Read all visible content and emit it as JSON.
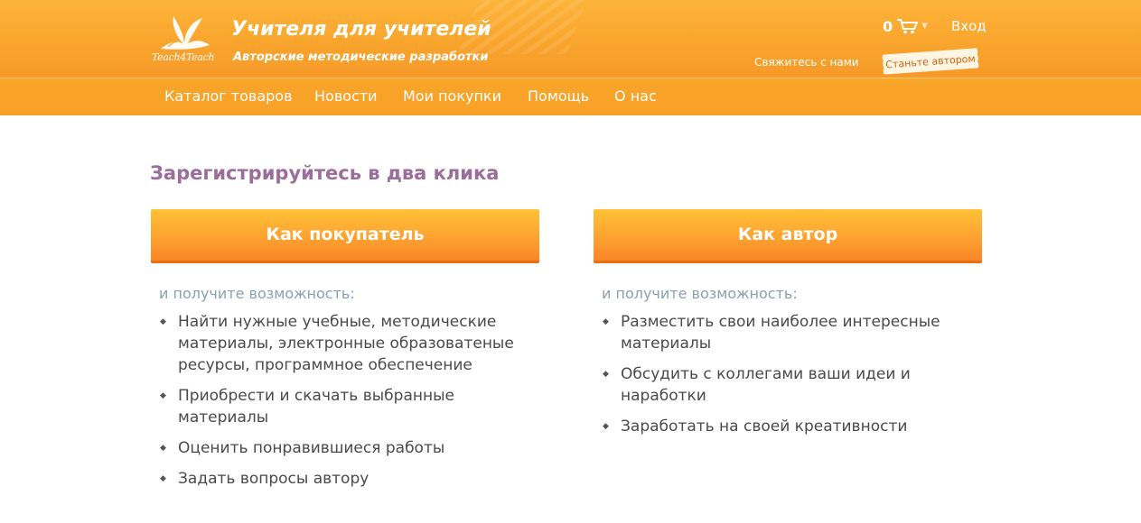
{
  "header": {
    "logo_text": "Teach4Teach",
    "site_title": "Учителя для учителей",
    "site_subtitle": "Авторские методические разработки",
    "cart_count": "0",
    "login_label": "Вход",
    "contact_label": "Свяжитесь с нами",
    "become_author_label": "Станьте автором"
  },
  "nav": {
    "items": [
      {
        "label": "Каталог товаров"
      },
      {
        "label": "Новости"
      },
      {
        "label": "Мои покупки"
      },
      {
        "label": "Помощь"
      },
      {
        "label": "О нас"
      }
    ]
  },
  "main": {
    "title": "Зарегистрируйтесь в два клика",
    "buyer": {
      "button_label": "Как покупатель",
      "intro": "и получите возможность:",
      "features": [
        "Найти нужные учебные, методические материалы, электронные образоватеные ресурсы, программное обеспечение",
        "Приобрести и скачать выбранные материалы",
        "Оценить понравившиеся работы",
        "Задать вопросы автору"
      ]
    },
    "author": {
      "button_label": "Как автор",
      "intro": "и получите возможность:",
      "features": [
        "Разместить свои наиболее интересные материалы",
        "Обсудить с коллегами ваши идеи и наработки",
        "Заработать на своей креативности"
      ]
    }
  },
  "colors": {
    "header_orange": "#f9a52d",
    "title_purple": "#9a6d9a",
    "intro_blue_gray": "#8aa0b3",
    "author_badge_text": "#d2630e"
  },
  "icons": {
    "logo": "leaf-crown-icon",
    "cart": "cart-icon",
    "bullet": "diamond-bullet-icon"
  }
}
